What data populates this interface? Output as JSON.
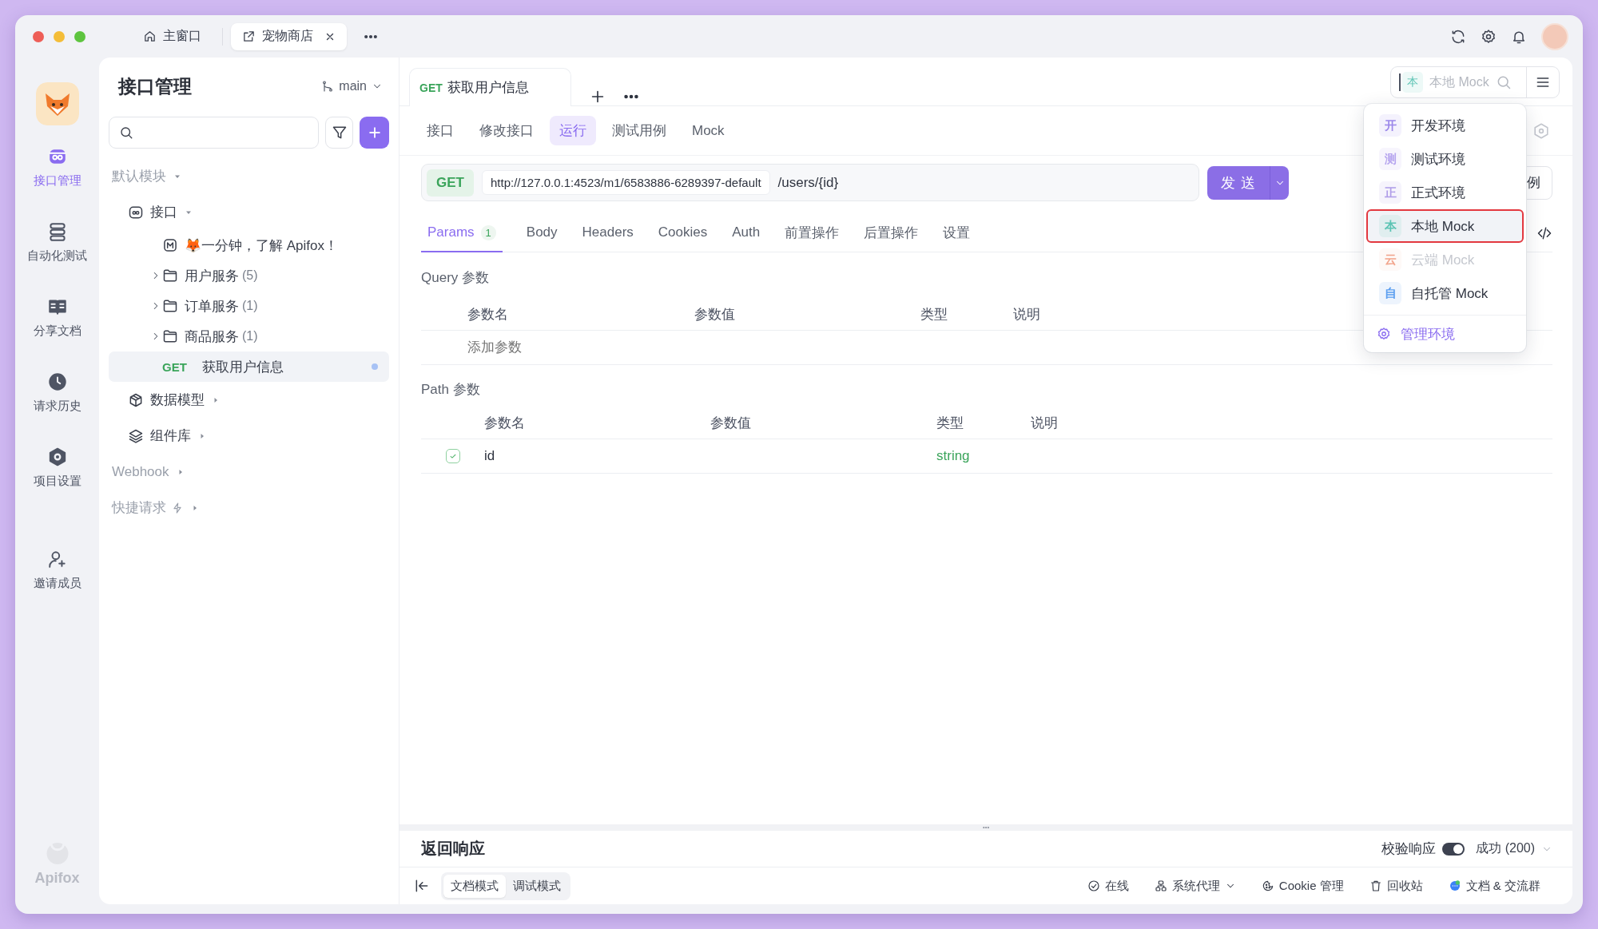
{
  "window": {
    "tabs": [
      {
        "label": "主窗口",
        "kind": "home",
        "selected": false,
        "closable": false
      },
      {
        "label": "宠物商店",
        "kind": "project",
        "selected": true,
        "closable": true
      }
    ]
  },
  "rail": {
    "items": [
      {
        "label": "接口管理",
        "kind": "api",
        "selected": true
      },
      {
        "label": "自动化测试",
        "kind": "automation",
        "selected": false
      },
      {
        "label": "分享文档",
        "kind": "docs",
        "selected": false
      },
      {
        "label": "请求历史",
        "kind": "history",
        "selected": false
      },
      {
        "label": "项目设置",
        "kind": "settings",
        "selected": false
      },
      {
        "label": "邀请成员",
        "kind": "invite",
        "selected": false
      }
    ],
    "brand": "Apifox"
  },
  "sidebar": {
    "title": "接口管理",
    "branch": "main",
    "tree": [
      {
        "kind": "module",
        "label": "默认模块",
        "expanded": true,
        "children": [
          {
            "kind": "group",
            "label": "接口",
            "expanded": true,
            "children": [
              {
                "kind": "doc",
                "label": "🦊一分钟，了解 Apifox！"
              },
              {
                "kind": "folder",
                "label": "用户服务",
                "count": "(5)",
                "expanded": false
              },
              {
                "kind": "folder",
                "label": "订单服务",
                "count": "(1)",
                "expanded": false
              },
              {
                "kind": "folder",
                "label": "商品服务",
                "count": "(1)",
                "expanded": false
              },
              {
                "kind": "endpoint",
                "method": "GET",
                "label": "获取用户信息",
                "selected": true,
                "unsaved": true
              }
            ]
          },
          {
            "kind": "models",
            "label": "数据模型",
            "expanded": false
          },
          {
            "kind": "components",
            "label": "组件库",
            "expanded": false
          }
        ]
      },
      {
        "kind": "module",
        "label": "Webhook",
        "expanded": false
      },
      {
        "kind": "shortcut",
        "label": "快捷请求",
        "expanded": false
      }
    ]
  },
  "main": {
    "tabs": [
      {
        "method": "GET",
        "label": "获取用户信息",
        "selected": true
      }
    ],
    "env": {
      "badge": "本",
      "label": "本地 Mock",
      "color": "#5cc4b4"
    },
    "sub_tabs": [
      {
        "label": "接口",
        "selected": false
      },
      {
        "label": "修改接口",
        "selected": false
      },
      {
        "label": "运行",
        "selected": true
      },
      {
        "label": "测试用例",
        "selected": false
      },
      {
        "label": "Mock",
        "selected": false
      }
    ],
    "request": {
      "method": "GET",
      "base_url": "http://127.0.0.1:4523/m1/6583886-6289397-default",
      "path": "/users/{id}",
      "send": "发 送",
      "save": "例"
    },
    "param_tabs": [
      {
        "label": "Params",
        "badge": "1",
        "selected": true
      },
      {
        "label": "Body",
        "selected": false
      },
      {
        "label": "Headers",
        "selected": false
      },
      {
        "label": "Cookies",
        "selected": false
      },
      {
        "label": "Auth",
        "selected": false
      },
      {
        "label": "前置操作",
        "selected": false
      },
      {
        "label": "后置操作",
        "selected": false
      },
      {
        "label": "设置",
        "selected": false
      }
    ],
    "query": {
      "title": "Query 参数",
      "columns": [
        "参数名",
        "参数值",
        "类型",
        "说明"
      ],
      "placeholder": "添加参数"
    },
    "path": {
      "title": "Path 参数",
      "columns": [
        "参数名",
        "参数值",
        "类型",
        "说明"
      ],
      "rows": [
        {
          "enabled": true,
          "name": "id",
          "type": "string"
        }
      ]
    },
    "response": {
      "title": "返回响应",
      "validate": {
        "label": "校验响应",
        "on": true
      },
      "status": "成功 (200)"
    },
    "status_bar": {
      "modes": [
        {
          "label": "文档模式",
          "selected": true
        },
        {
          "label": "调试模式",
          "selected": false
        }
      ],
      "items": [
        {
          "kind": "online",
          "label": "在线"
        },
        {
          "kind": "proxy",
          "label": "系统代理",
          "dropdown": true
        },
        {
          "kind": "cookie",
          "label": "Cookie 管理"
        },
        {
          "kind": "trash",
          "label": "回收站"
        },
        {
          "kind": "community",
          "label": "文档 & 交流群"
        }
      ]
    }
  },
  "env_menu": {
    "items": [
      {
        "badge": "开",
        "label": "开发环境",
        "color": "#9c88ea",
        "selected": false,
        "disabled": false,
        "highlighted": false
      },
      {
        "badge": "测",
        "label": "测试环境",
        "color": "#b7a6ef",
        "selected": false,
        "disabled": false,
        "highlighted": false
      },
      {
        "badge": "正",
        "label": "正式环境",
        "color": "#b09de8",
        "selected": false,
        "disabled": false,
        "highlighted": false
      },
      {
        "badge": "本",
        "label": "本地 Mock",
        "color": "#5cc4b4",
        "selected": true,
        "disabled": false,
        "highlighted": true
      },
      {
        "badge": "云",
        "label": "云端 Mock",
        "color": "#f2a58c",
        "selected": false,
        "disabled": true,
        "highlighted": false
      },
      {
        "badge": "自",
        "label": "自托管 Mock",
        "color": "#5b9ef0",
        "selected": false,
        "disabled": false,
        "highlighted": false
      }
    ],
    "manage": "管理环境"
  }
}
